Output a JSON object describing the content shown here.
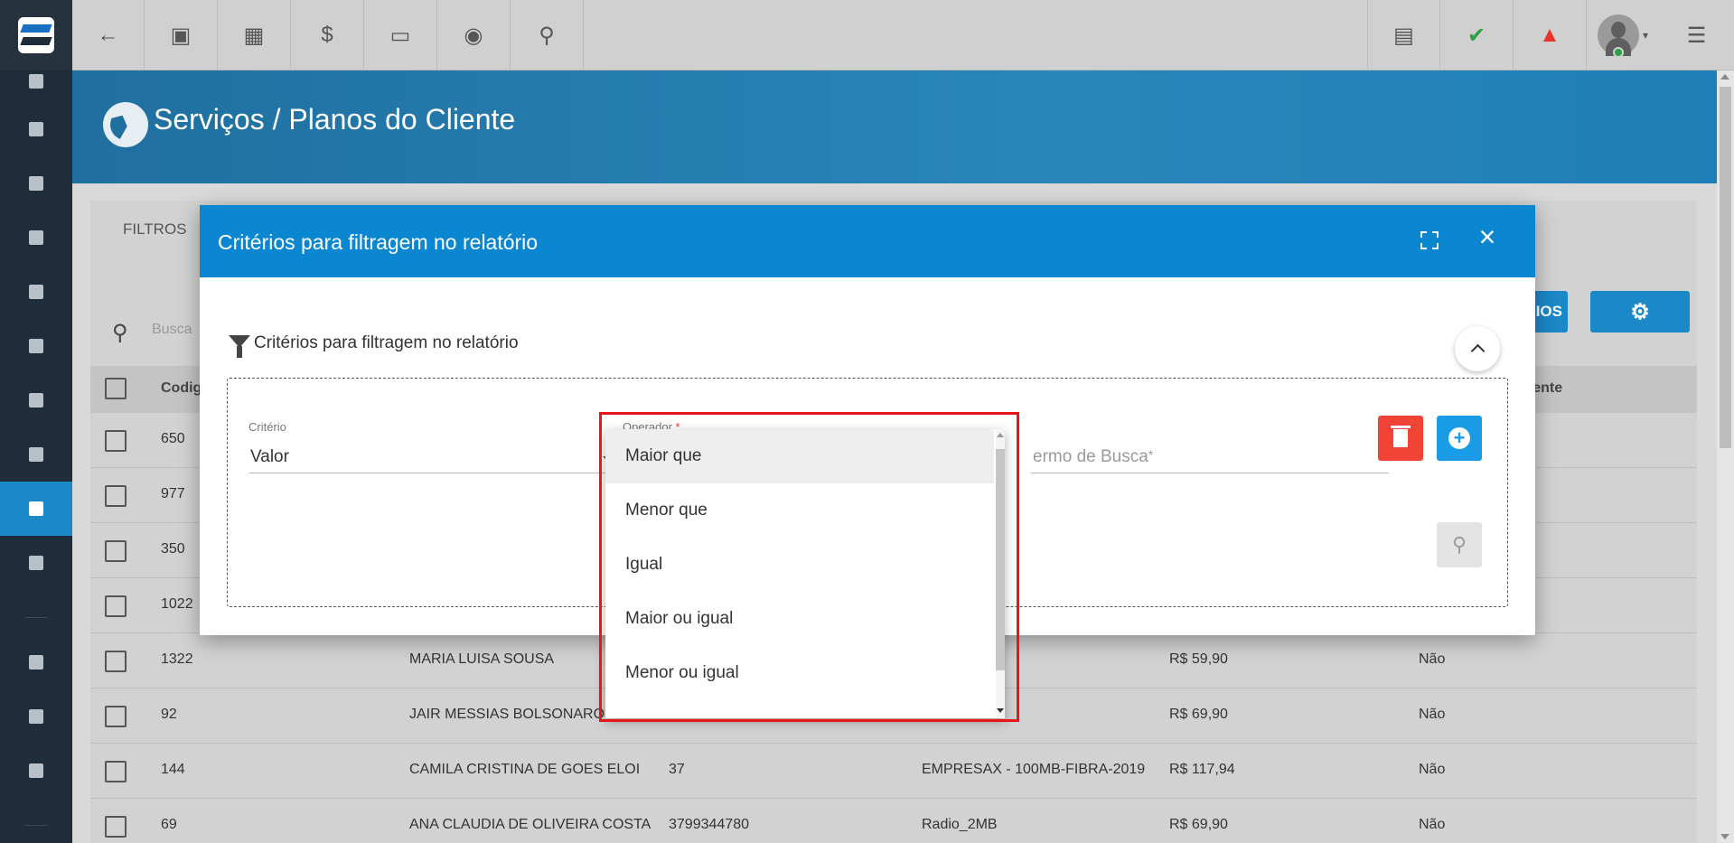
{
  "topbar": {
    "buttons": [
      {
        "name": "back",
        "glyph": "←"
      },
      {
        "name": "contact",
        "glyph": "▣"
      },
      {
        "name": "calendar",
        "glyph": "▦"
      },
      {
        "name": "money",
        "glyph": "$"
      },
      {
        "name": "terminal",
        "glyph": "▭"
      },
      {
        "name": "eye",
        "glyph": "◉"
      },
      {
        "name": "search",
        "glyph": "⚲"
      }
    ],
    "right": [
      {
        "name": "pdf",
        "glyph": "▤"
      },
      {
        "name": "check",
        "glyph": "✔",
        "color": "#2ea043"
      },
      {
        "name": "alarm",
        "glyph": "▲",
        "color": "#e5342a"
      },
      {
        "name": "menu",
        "glyph": "☰"
      }
    ]
  },
  "header": {
    "title": "Serviços / Planos do Cliente"
  },
  "card": {
    "filters_tab": "FILTROS",
    "search_placeholder": "Busca",
    "report_button_fragment": "IOS",
    "settings_button_glyph": "⚙"
  },
  "table": {
    "headers": [
      "Codig",
      "rente"
    ],
    "rows": [
      {
        "code": "650",
        "name": "",
        "contract": "",
        "plan": "",
        "value": "",
        "recurring": ""
      },
      {
        "code": "977",
        "name": "",
        "contract": "",
        "plan": "",
        "value": "",
        "recurring": ""
      },
      {
        "code": "350",
        "name": "",
        "contract": "",
        "plan": "",
        "value": "",
        "recurring": ""
      },
      {
        "code": "1022",
        "name": "",
        "contract": "",
        "plan": "",
        "value": "",
        "recurring": ""
      },
      {
        "code": "1322",
        "name": "MARIA LUISA SOUSA",
        "contract": "",
        "plan": "",
        "value": "R$ 59,90",
        "recurring": "Não"
      },
      {
        "code": "92",
        "name": "JAIR MESSIAS BOLSONARO",
        "contract": "",
        "plan": "",
        "value": "R$ 69,90",
        "recurring": "Não"
      },
      {
        "code": "144",
        "name": "CAMILA CRISTINA DE GOES ELOI",
        "contract": "37",
        "plan": "EMPRESAX - 100MB-FIBRA-2019",
        "value": "R$ 117,94",
        "recurring": "Não"
      },
      {
        "code": "69",
        "name": "ANA CLAUDIA DE OLIVEIRA COSTA",
        "contract": "3799344780",
        "plan": "Radio_2MB",
        "value": "R$ 69,90",
        "recurring": "Não"
      }
    ]
  },
  "modal": {
    "title": "Critérios para filtragem no relatório",
    "section_title": "Critérios para filtragem no relatório",
    "criterio_label": "Critério",
    "criterio_value": "Valor",
    "operador_label": "Operador",
    "required_mark": "*",
    "termo_placeholder": "Termo de Busca",
    "termo_visible": "ermo de Busca"
  },
  "dropdown": {
    "options": [
      "Maior que",
      "Menor que",
      "Igual",
      "Maior ou igual",
      "Menor ou igual"
    ],
    "highlighted_index": 0
  }
}
